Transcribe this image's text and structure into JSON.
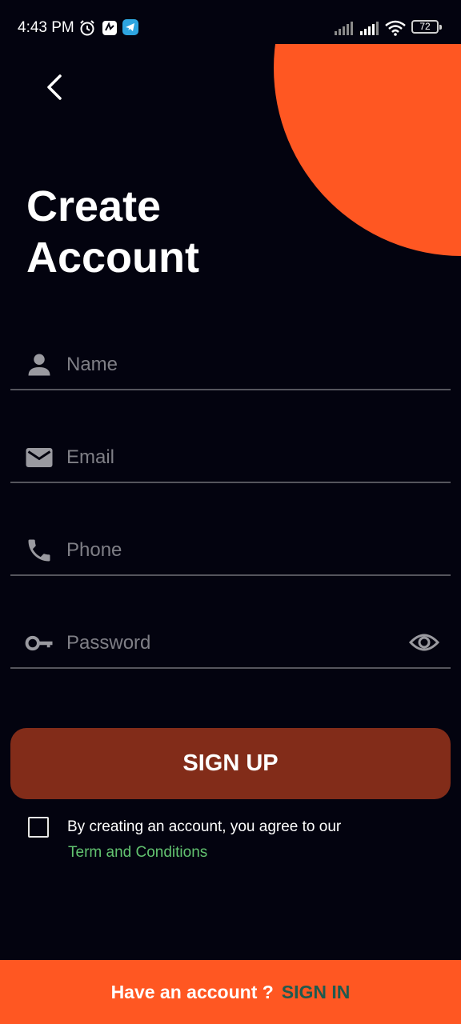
{
  "status_bar": {
    "time": "4:43 PM",
    "battery_level": "72",
    "icons": [
      "alarm-icon",
      "app-notification-icon",
      "telegram-icon",
      "signal-icon",
      "signal-icon",
      "wifi-icon",
      "battery-icon"
    ]
  },
  "header": {
    "back_icon": "chevron-left-icon",
    "title": "Create Account"
  },
  "form": {
    "name": {
      "placeholder": "Name",
      "value": "",
      "icon": "person-icon"
    },
    "email": {
      "placeholder": "Email",
      "value": "",
      "icon": "mail-icon"
    },
    "phone": {
      "placeholder": "Phone",
      "value": "",
      "icon": "phone-icon"
    },
    "password": {
      "placeholder": "Password",
      "value": "",
      "icon": "key-icon",
      "toggle_icon": "eye-icon"
    }
  },
  "signup_button": {
    "label": "SIGN UP"
  },
  "terms": {
    "checked": false,
    "text": "By creating an account, you agree to our",
    "link": "Term and Conditions"
  },
  "footer": {
    "prompt": "Have an account ?",
    "link": "SIGN IN"
  },
  "colors": {
    "background": "#03030f",
    "accent_orange": "#ff5722",
    "signup_button": "#822c19",
    "terms_link": "#62c370",
    "signin_link": "#1f5a4f"
  }
}
